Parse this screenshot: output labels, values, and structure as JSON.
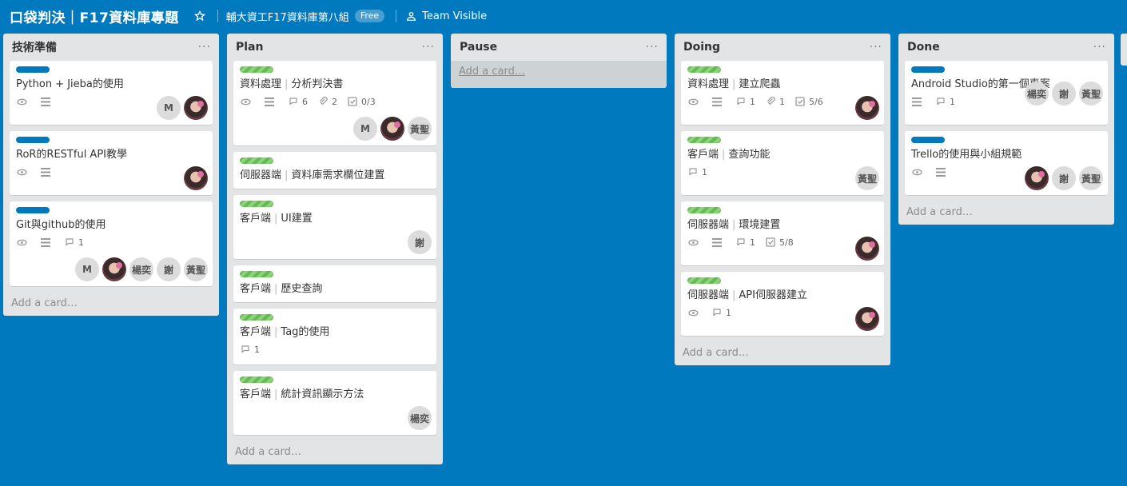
{
  "header": {
    "board_title": "口袋判決｜F17資料庫專題",
    "org_name": "輔大資工F17資料庫第八組",
    "plan_badge": "Free",
    "visibility": "Team Visible"
  },
  "colors": {
    "board_bg": "#0079bf",
    "label_blue": "#0079bf",
    "label_green": "#61bd4f"
  },
  "lists": [
    {
      "title": "技術準備",
      "add_card": "Add a card…",
      "cards": [
        {
          "label": "blue",
          "title": "Python + Jieba的使用",
          "badges": {
            "watch": true,
            "desc": true
          },
          "members": [
            "M",
            "avatar"
          ]
        },
        {
          "label": "blue",
          "title": "RoR的RESTful API教學",
          "badges": {
            "watch": true,
            "desc": true
          },
          "members": [
            "avatar"
          ]
        },
        {
          "label": "blue",
          "title": "Git與github的使用",
          "badges": {
            "watch": true,
            "desc": true,
            "comments": "1"
          },
          "members": [
            "M",
            "avatar",
            "楊奕",
            "謝",
            "黃聖"
          ]
        }
      ]
    },
    {
      "title": "Plan",
      "add_card": "Add a card…",
      "cards": [
        {
          "label": "green",
          "title_a": "資料處理",
          "title_b": "分析判決書",
          "badges": {
            "watch": true,
            "desc": true,
            "comments": "6",
            "attachments": "2",
            "checklist": "0/3"
          },
          "members": [
            "M",
            "avatar",
            "黃聖"
          ]
        },
        {
          "label": "green",
          "title_a": "伺服器端",
          "title_b": "資料庫需求欄位建置",
          "badges": {},
          "members": []
        },
        {
          "label": "green",
          "title_a": "客戶端",
          "title_b": "UI建置",
          "badges": {},
          "members": [
            "謝"
          ]
        },
        {
          "label": "green",
          "title_a": "客戶端",
          "title_b": "歷史查詢",
          "badges": {},
          "members": []
        },
        {
          "label": "green",
          "title_a": "客戶端",
          "title_b": "Tag的使用",
          "badges": {
            "comments": "1"
          },
          "members": []
        },
        {
          "label": "green",
          "title_a": "客戶端",
          "title_b": "統計資訊顯示方法",
          "badges": {},
          "members": [
            "楊奕"
          ]
        }
      ]
    },
    {
      "title": "Pause",
      "add_card": "Add a card…",
      "cards": []
    },
    {
      "title": "Doing",
      "add_card": "Add a card…",
      "cards": [
        {
          "label": "green",
          "title_a": "資料處理",
          "title_b": "建立爬蟲",
          "badges": {
            "watch": true,
            "desc": true,
            "comments": "1",
            "attachments": "1",
            "checklist": "5/6"
          },
          "members": [
            "avatar"
          ]
        },
        {
          "label": "green",
          "title_a": "客戶端",
          "title_b": "查詢功能",
          "badges": {
            "comments": "1"
          },
          "members": [
            "黃聖"
          ]
        },
        {
          "label": "green",
          "title_a": "伺服器端",
          "title_b": "環境建置",
          "badges": {
            "watch": true,
            "desc": true,
            "comments": "1",
            "checklist": "5/8"
          },
          "members": [
            "avatar"
          ]
        },
        {
          "label": "green",
          "title_a": "伺服器端",
          "title_b": "API伺服器建立",
          "badges": {
            "watch": true,
            "comments": "1"
          },
          "members": [
            "avatar"
          ]
        }
      ]
    },
    {
      "title": "Done",
      "add_card": "Add a card…",
      "cards": [
        {
          "label": "blue",
          "title": "Android Studio的第一個專案",
          "badges": {
            "desc": true,
            "comments": "1"
          },
          "members": [
            "楊奕",
            "謝",
            "黃聖"
          ]
        },
        {
          "label": "blue",
          "title": "Trello的使用與小組規範",
          "badges": {
            "watch": true,
            "desc": true
          },
          "members": [
            "avatar",
            "謝",
            "黃聖"
          ]
        }
      ]
    }
  ]
}
